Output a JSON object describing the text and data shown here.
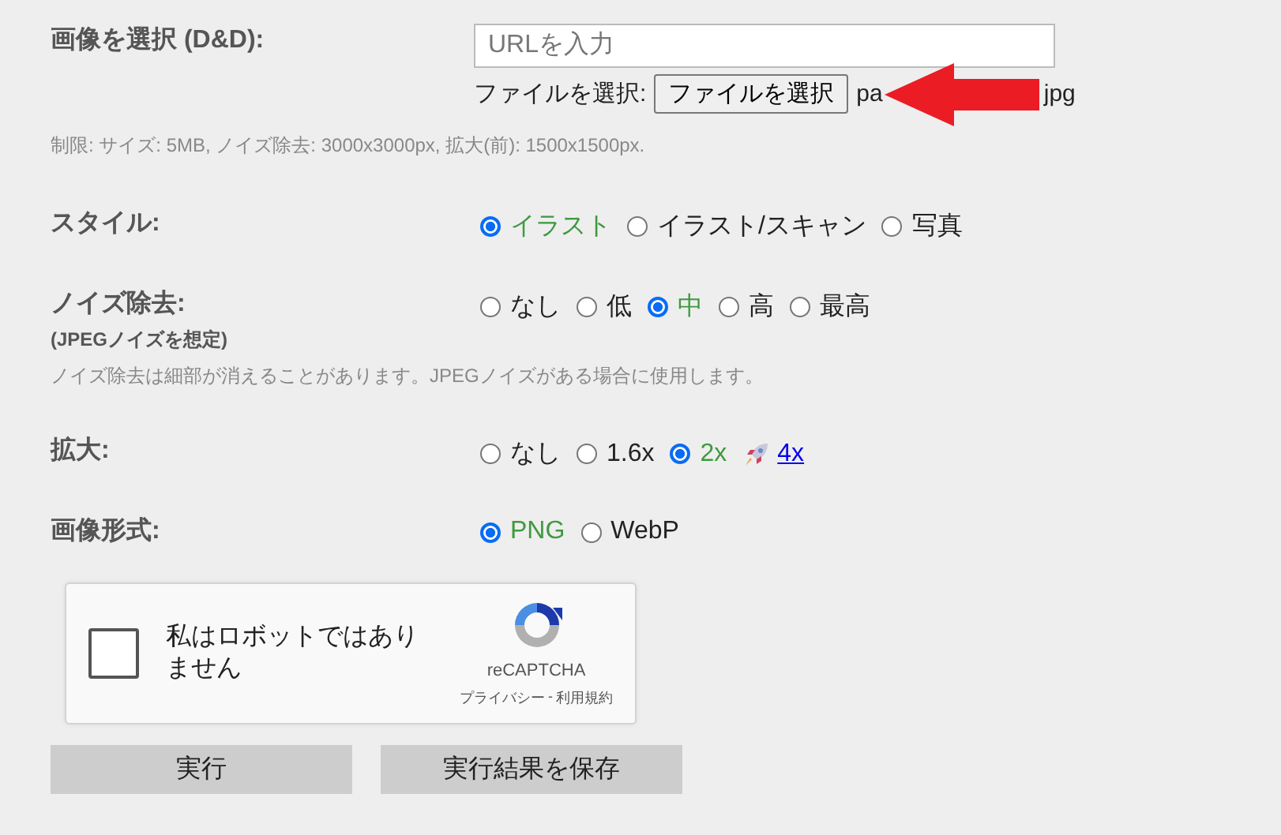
{
  "image_select": {
    "label": "画像を選択 (D&D):",
    "url_field": {
      "placeholder": "URLを入力"
    },
    "file_label": "ファイルを選択:",
    "file_button": "ファイルを選択",
    "file_name_parts": [
      "pa",
      "jpg"
    ]
  },
  "limits_note": "制限: サイズ: 5MB, ノイズ除去: 3000x3000px, 拡大(前): 1500x1500px.",
  "options": [
    {
      "label": "スタイル:",
      "choices": [
        {
          "kind": "radio",
          "label": "イラスト",
          "selected": true
        },
        {
          "kind": "radio",
          "label": "イラスト/スキャン",
          "selected": false
        },
        {
          "kind": "radio",
          "label": "写真",
          "selected": false
        }
      ]
    },
    {
      "label": "ノイズ除去:",
      "sublabel": "(JPEGノイズを想定)",
      "note": "ノイズ除去は細部が消えることがあります。JPEGノイズがある場合に使用します。",
      "choices": [
        {
          "kind": "radio",
          "label": "なし",
          "selected": false
        },
        {
          "kind": "radio",
          "label": "低",
          "selected": false
        },
        {
          "kind": "radio",
          "label": "中",
          "selected": true
        },
        {
          "kind": "radio",
          "label": "高",
          "selected": false
        },
        {
          "kind": "radio",
          "label": "最高",
          "selected": false
        }
      ]
    },
    {
      "label": "拡大:",
      "choices": [
        {
          "kind": "radio",
          "label": "なし",
          "selected": false
        },
        {
          "kind": "radio",
          "label": "1.6x",
          "selected": false
        },
        {
          "kind": "radio",
          "label": "2x",
          "selected": true
        },
        {
          "kind": "link",
          "label": "4x"
        }
      ]
    },
    {
      "label": "画像形式:",
      "choices": [
        {
          "kind": "radio",
          "label": "PNG",
          "selected": true
        },
        {
          "kind": "radio",
          "label": "WebP",
          "selected": false
        }
      ]
    }
  ],
  "recaptcha": {
    "checkbox_label": "私はロボットではありません",
    "checked": false,
    "brand": "reCAPTCHA",
    "privacy": "プライバシー",
    "separator": "-",
    "terms": "利用規約"
  },
  "buttons": [
    "実行",
    "実行結果を保存"
  ]
}
